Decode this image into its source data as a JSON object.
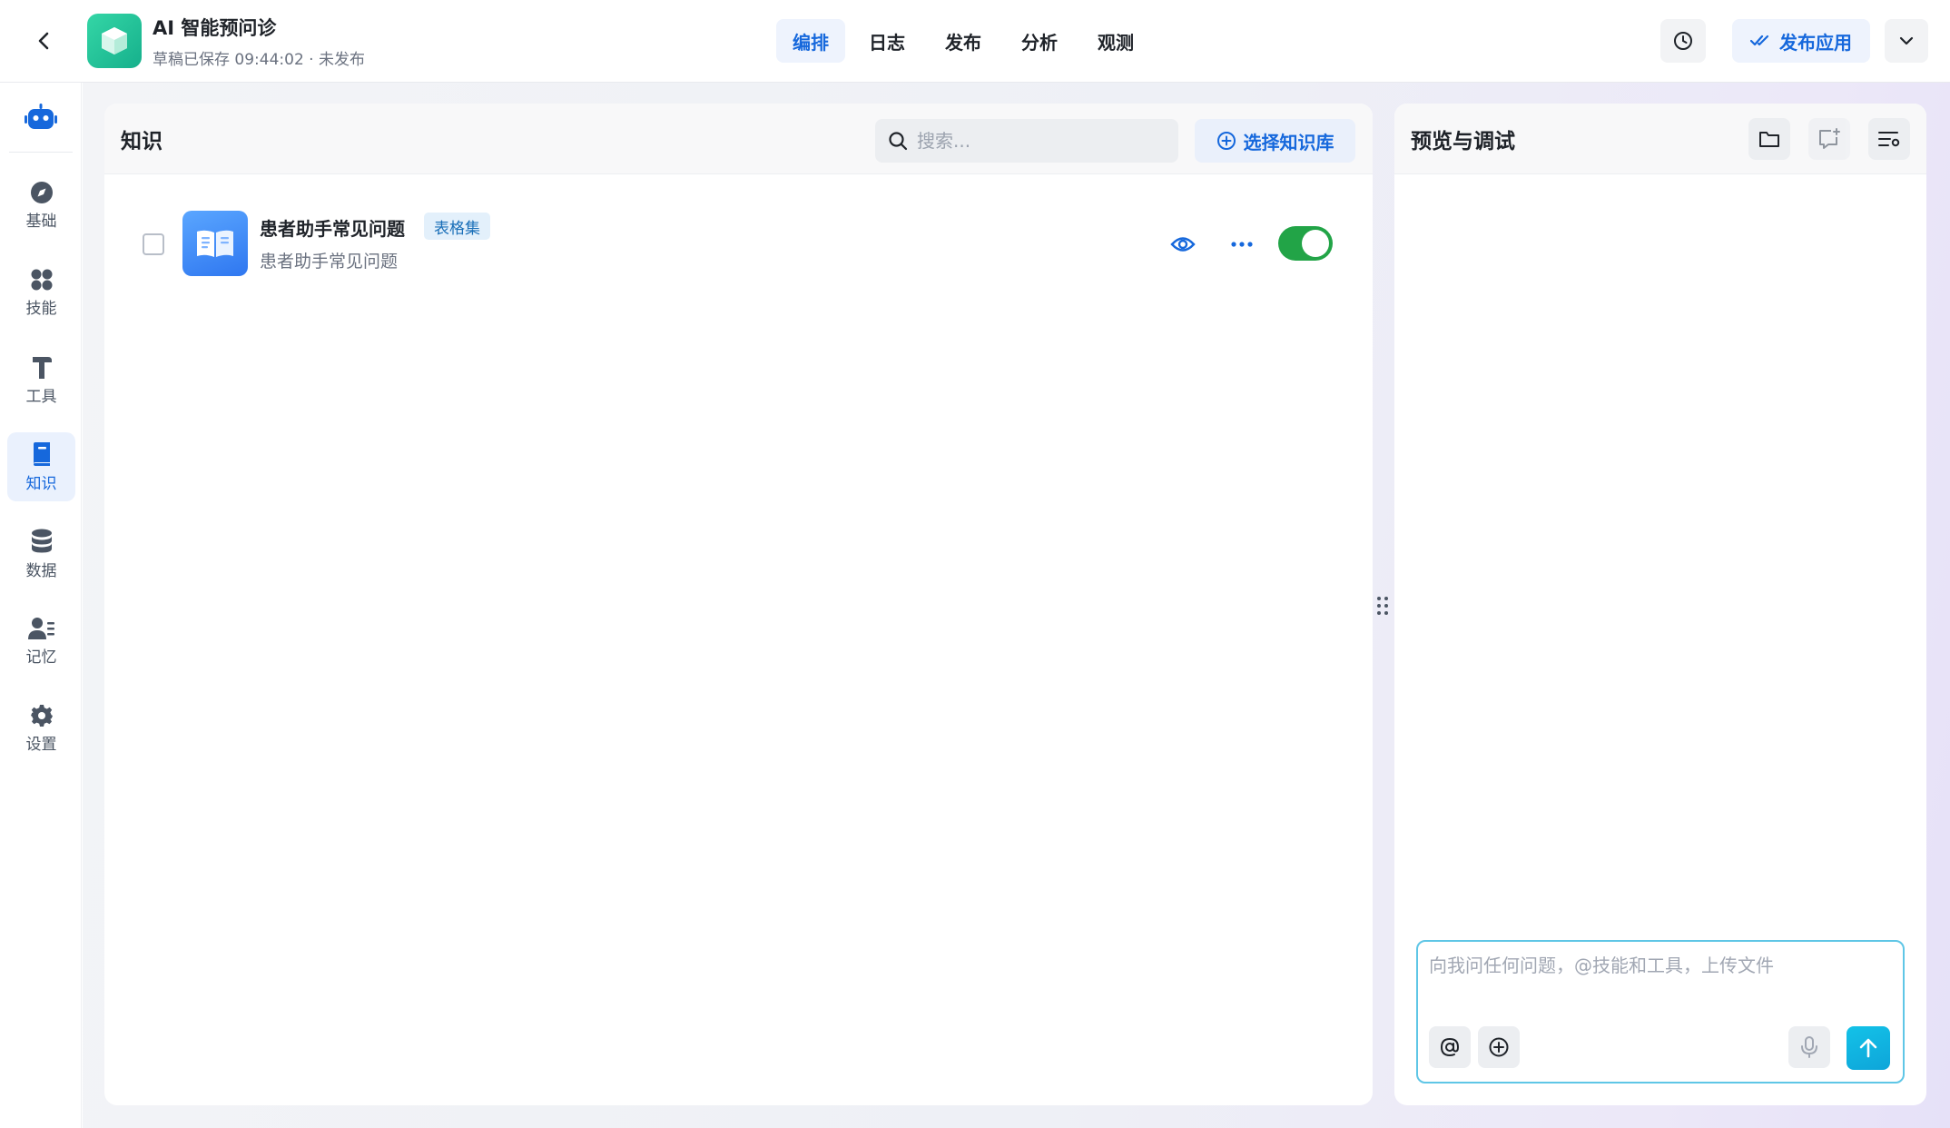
{
  "header": {
    "app_name": "AI 智能预问诊",
    "app_status": "草稿已保存 09:44:02 · 未发布",
    "tabs": [
      {
        "label": "编排",
        "active": true
      },
      {
        "label": "日志",
        "active": false
      },
      {
        "label": "发布",
        "active": false
      },
      {
        "label": "分析",
        "active": false
      },
      {
        "label": "观测",
        "active": false
      }
    ],
    "publish_label": "发布应用",
    "icons": {
      "back": "chevron-left-icon",
      "history": "clock-icon",
      "publish": "double-check-icon",
      "more": "chevron-down-icon"
    }
  },
  "sidebar": {
    "top_icon": "robot-icon",
    "items": [
      {
        "label": "基础",
        "icon": "compass-icon",
        "active": false
      },
      {
        "label": "技能",
        "icon": "grid-icon",
        "active": false
      },
      {
        "label": "工具",
        "icon": "hammer-icon",
        "active": false
      },
      {
        "label": "知识",
        "icon": "book-icon",
        "active": true
      },
      {
        "label": "数据",
        "icon": "database-icon",
        "active": false
      },
      {
        "label": "记忆",
        "icon": "user-memory-icon",
        "active": false
      },
      {
        "label": "设置",
        "icon": "gear-icon",
        "active": false
      }
    ]
  },
  "knowledge": {
    "title": "知识",
    "search_placeholder": "搜索...",
    "choose_label": "选择知识库",
    "items": [
      {
        "title": "患者助手常见问题",
        "tag": "表格集",
        "description": "患者助手常见问题",
        "checked": false,
        "enabled": true
      }
    ]
  },
  "preview": {
    "title": "预览与调试",
    "chat_placeholder": "向我问任何问题，@技能和工具，上传文件",
    "icons": [
      "folder-icon",
      "new-chat-icon",
      "settings-list-icon",
      "at-icon",
      "plus-circle-icon",
      "mic-icon",
      "arrow-up-icon"
    ]
  },
  "colors": {
    "accent": "#1668dc",
    "toggle_on": "#22a447",
    "send": "#13c2e8",
    "logo": "#16b08c"
  }
}
